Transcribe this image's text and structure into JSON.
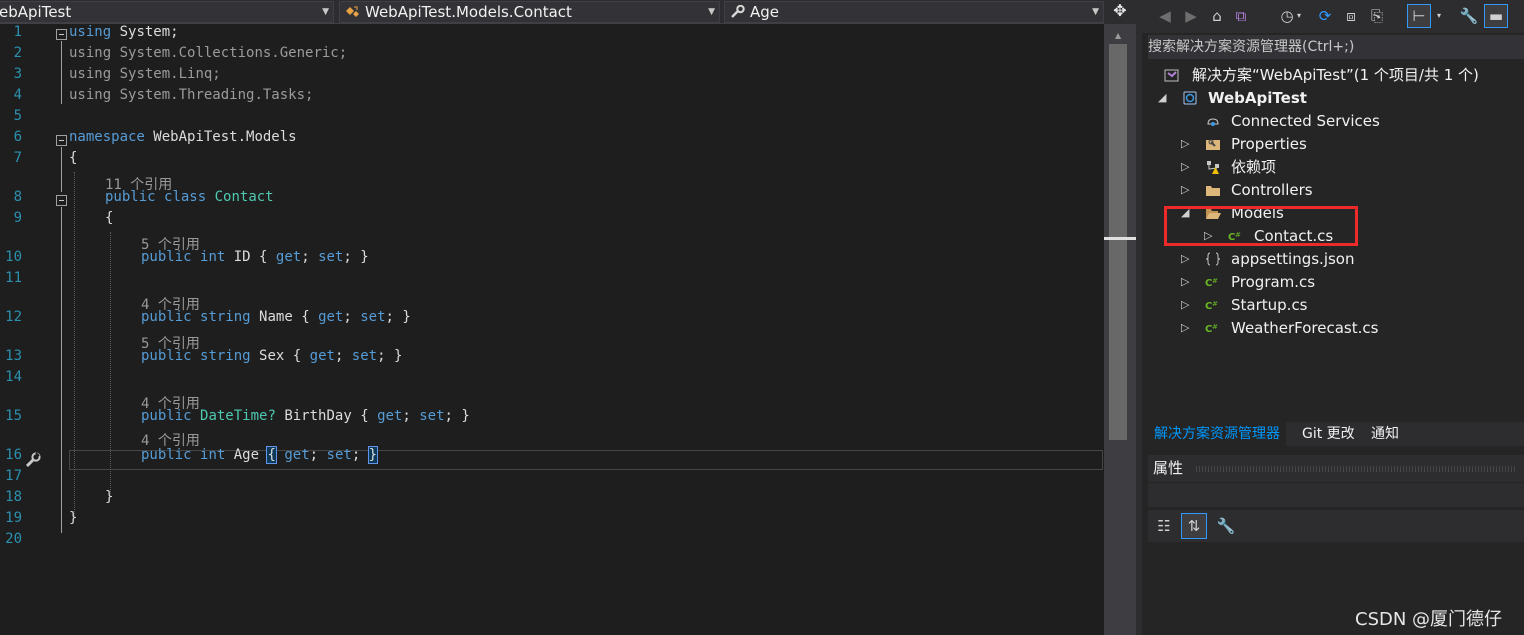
{
  "navbar": {
    "project": "ebApiTest",
    "type_path": "WebApiTest.Models.Contact",
    "member": "Age"
  },
  "code_lines": [
    {
      "n": "1",
      "kind": "using",
      "ns": "System;"
    },
    {
      "n": "2",
      "kind": "using-dim",
      "ns": "System.Collections.Generic;"
    },
    {
      "n": "3",
      "kind": "using-dim",
      "ns": "System.Linq;"
    },
    {
      "n": "4",
      "kind": "using-dim",
      "ns": "System.Threading.Tasks;"
    },
    {
      "n": "5"
    },
    {
      "n": "6",
      "kind": "namespace",
      "ns": "WebApiTest.Models"
    },
    {
      "n": "7",
      "text": "{"
    },
    {
      "n": "8",
      "lens": "11 个引用",
      "kind": "class",
      "name": "Contact"
    },
    {
      "n": "9",
      "text": "{"
    },
    {
      "n": "10",
      "lens": "5 个引用",
      "kind": "prop",
      "type": "int",
      "name": "ID",
      "type_kind": "kw"
    },
    {
      "n": "11"
    },
    {
      "n": "12",
      "lens": "4 个引用",
      "kind": "prop",
      "type": "string",
      "name": "Name",
      "type_kind": "kw"
    },
    {
      "n": "13",
      "lens": "5 个引用",
      "kind": "prop",
      "type": "string",
      "name": "Sex",
      "type_kind": "kw"
    },
    {
      "n": "14"
    },
    {
      "n": "15",
      "lens": "4 个引用",
      "kind": "prop",
      "type": "DateTime?",
      "name": "BirthDay",
      "type_kind": "ty"
    },
    {
      "n": "16",
      "lens": "4 个引用",
      "kind": "prop",
      "type": "int",
      "name": "Age",
      "type_kind": "kw",
      "current": true
    },
    {
      "n": "17"
    },
    {
      "n": "18",
      "text": "}"
    },
    {
      "n": "19",
      "text": "}"
    },
    {
      "n": "20"
    }
  ],
  "keywords": {
    "using": "using",
    "namespace": "namespace",
    "public": "public",
    "class": "class",
    "get": "get",
    "set": "set"
  },
  "solution_explorer": {
    "search_placeholder": "搜索解决方案资源管理器(Ctrl+;)",
    "solution_label": "解决方案“WebApiTest”(1 个项目/共 1 个)",
    "items": [
      {
        "label": "WebApiTest",
        "icon": "project-icon",
        "depth": 0,
        "expander": "expanded",
        "bold": true
      },
      {
        "label": "Connected Services",
        "icon": "connected-services-icon",
        "depth": 1,
        "expander": "none"
      },
      {
        "label": "Properties",
        "icon": "properties-icon",
        "depth": 1,
        "expander": "collapsed"
      },
      {
        "label": "依赖项",
        "icon": "dependencies-warning-icon",
        "depth": 1,
        "expander": "collapsed"
      },
      {
        "label": "Controllers",
        "icon": "folder-icon",
        "depth": 1,
        "expander": "collapsed"
      },
      {
        "label": "Models",
        "icon": "folder-open-icon",
        "depth": 1,
        "expander": "expanded"
      },
      {
        "label": "Contact.cs",
        "icon": "csharp-file-icon",
        "depth": 2,
        "expander": "collapsed"
      },
      {
        "label": "appsettings.json",
        "icon": "json-file-icon",
        "depth": 1,
        "expander": "collapsed"
      },
      {
        "label": "Program.cs",
        "icon": "csharp-file-icon",
        "depth": 1,
        "expander": "collapsed"
      },
      {
        "label": "Startup.cs",
        "icon": "csharp-file-icon",
        "depth": 1,
        "expander": "collapsed"
      },
      {
        "label": "WeatherForecast.cs",
        "icon": "csharp-file-icon",
        "depth": 1,
        "expander": "collapsed"
      }
    ],
    "tabs": [
      "解决方案资源管理器",
      "Git 更改",
      "通知"
    ],
    "active_tab": "解决方案资源管理器"
  },
  "properties": {
    "title": "属性"
  },
  "watermark": "CSDN @厦门德仔",
  "colors": {
    "keyword": "#569cd6",
    "type": "#4ec9b0",
    "line_number": "#2b91af",
    "highlight_box": "#ec2a2a",
    "active_tab": "#0097fb"
  }
}
